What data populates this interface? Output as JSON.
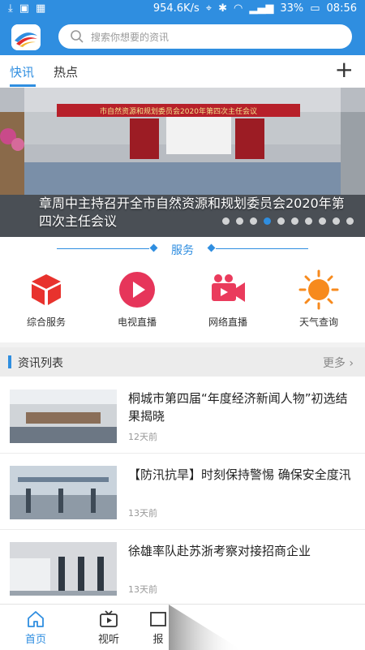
{
  "status_bar": {
    "speed": "954.6K/s",
    "battery": "33%",
    "time": "08:56"
  },
  "search": {
    "placeholder": "搜索你想要的资讯"
  },
  "tabs": [
    {
      "label": "快讯",
      "active": true
    },
    {
      "label": "热点",
      "active": false
    }
  ],
  "banner": {
    "title": "章周中主持召开全市自然资源和规划委员会2020年第四次主任会议",
    "sign_text": "市自然资源和规划委员会2020年第四次主任会议",
    "slide_count": 10,
    "active_index": 3
  },
  "services": {
    "title": "服务",
    "items": [
      {
        "label": "综合服务",
        "icon": "cube-icon"
      },
      {
        "label": "电视直播",
        "icon": "play-icon"
      },
      {
        "label": "网络直播",
        "icon": "video-camera-icon"
      },
      {
        "label": "天气查询",
        "icon": "sun-icon"
      }
    ]
  },
  "news_section": {
    "title": "资讯列表",
    "more": "更多"
  },
  "news": [
    {
      "title": "桐城市第四届“年度经济新闻人物”初选结果揭晓",
      "time": "12天前"
    },
    {
      "title": "【防汛抗旱】时刻保持警惕 确保安全度汛",
      "time": "13天前"
    },
    {
      "title": "徐雄率队赴苏浙考察对接招商企业",
      "time": "13天前"
    }
  ],
  "bottom_nav": [
    {
      "label": "首页",
      "icon": "home-icon",
      "active": true
    },
    {
      "label": "视听",
      "icon": "tv-icon",
      "active": false
    },
    {
      "label": "报",
      "icon": "newspaper-icon",
      "active": false
    }
  ],
  "colors": {
    "primary": "#2f8ee0",
    "banner_sign": "#b7202a"
  }
}
